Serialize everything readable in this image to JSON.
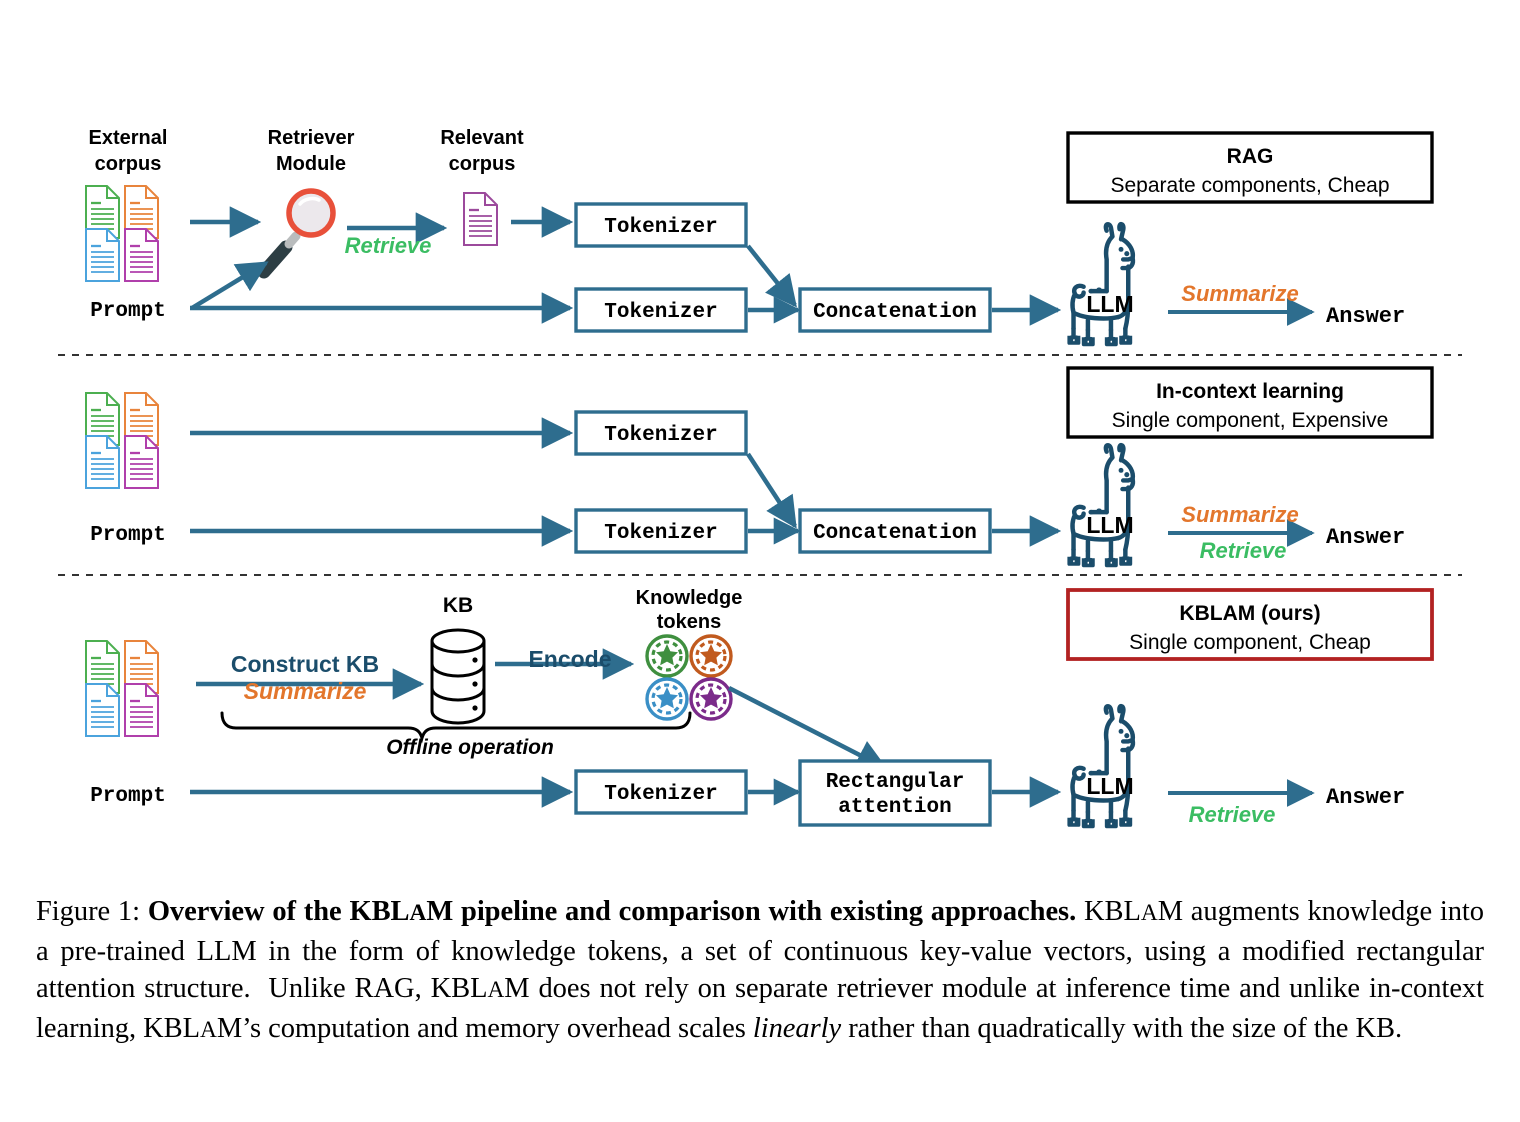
{
  "figure": {
    "rows": [
      {
        "id": "rag",
        "label_box": {
          "title": "RAG",
          "subtitle": "Separate components, Cheap",
          "border_color": "#000000"
        },
        "source_label_line1": "External",
        "source_label_line2": "corpus",
        "retriever_label_line1": "Retriever",
        "retriever_label_line2": "Module",
        "relevant_label_line1": "Relevant",
        "relevant_label_line2": "corpus",
        "retrieve_label": "Retrieve",
        "prompt_label": "Prompt",
        "tokenizer_top": "Tokenizer",
        "tokenizer_bottom": "Tokenizer",
        "concat_label": "Concatenation",
        "llm_label": "LLM",
        "edge_label_top": "Summarize",
        "answer_label": "Answer"
      },
      {
        "id": "icl",
        "label_box": {
          "title": "In-context learning",
          "subtitle": "Single component, Expensive",
          "border_color": "#000000"
        },
        "prompt_label": "Prompt",
        "tokenizer_top": "Tokenizer",
        "tokenizer_bottom": "Tokenizer",
        "concat_label": "Concatenation",
        "llm_label": "LLM",
        "edge_label_top": "Summarize",
        "edge_label_bottom": "Retrieve",
        "answer_label": "Answer"
      },
      {
        "id": "kblam",
        "label_box": {
          "title": "KBLAM (ours)",
          "subtitle": "Single component, Cheap",
          "border_color": "#b22222"
        },
        "construct_label": "Construct KB",
        "summarize_label": "Summarize",
        "kb_label": "KB",
        "encode_label": "Encode",
        "knowledge_label_line1": "Knowledge",
        "knowledge_label_line2": "tokens",
        "offline_label": "Offline operation",
        "prompt_label": "Prompt",
        "tokenizer": "Tokenizer",
        "attention_line1": "Rectangular",
        "attention_line2": "attention",
        "llm_label": "LLM",
        "edge_label_bottom": "Retrieve",
        "answer_label": "Answer"
      }
    ],
    "colors": {
      "arrow_blue": "#2e6d8e",
      "box_blue": "#2e6d8e",
      "llama_blue": "#1b4d6b",
      "green_accent": "#3bbd63",
      "orange_accent": "#e3762c",
      "kb_red": "#b22222",
      "doc_green": "#4caf50",
      "doc_orange": "#e8843c",
      "doc_blue": "#4ba3dd",
      "doc_purple": "#b03fab",
      "relevant_doc_purple": "#9c4a9c",
      "magnifier_red": "#e8503a",
      "magnifier_handle": "#2d3e44",
      "token_green": "#3f8f3f",
      "token_orange": "#c15a1e",
      "token_blue": "#3a8fc6",
      "token_purple": "#7b2b8a"
    },
    "doc_stack_colors": [
      "doc_green",
      "doc_orange",
      "doc_blue",
      "doc_purple"
    ]
  },
  "caption": {
    "prefix": "Figure 1:",
    "bold_title_a": "Overview of the ",
    "bold_title_kblam": "KBLaM",
    "bold_title_b": " pipeline and comparison with existing approaches.",
    "body": " KBLaM augments knowledge into a pre-trained LLM in the form of knowledge tokens, a set of continuous key-value vectors, using a modified rectangular attention structure.  Unlike RAG, KBLaM does not rely on separate retriever module at inference time and unlike in-context learning, KBLaM's computation and memory overhead scales linearly rather than quadratically with the size of the KB.",
    "italic_word": "linearly"
  }
}
